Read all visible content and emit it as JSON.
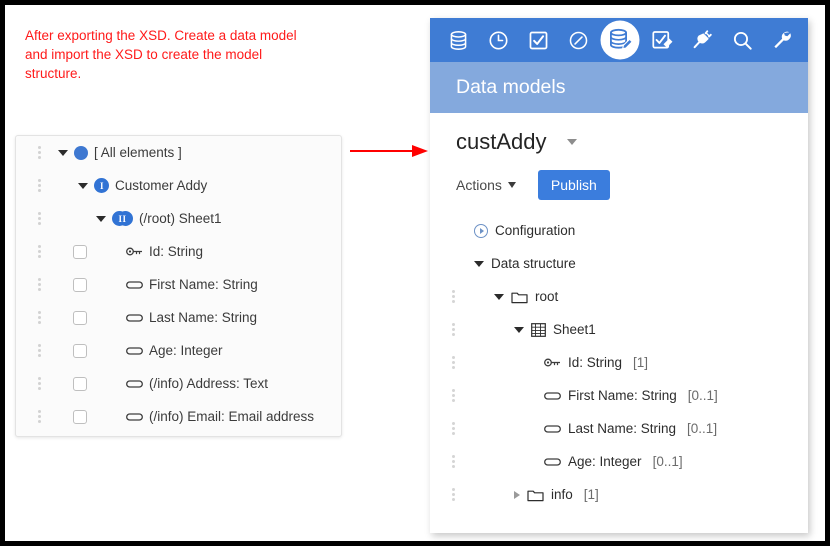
{
  "annotation": {
    "text": "After exporting the XSD. Create a data model and import the XSD to create the model structure.",
    "color": "#ff1a1a"
  },
  "arrow": {
    "name": "red-arrow",
    "color": "#ff0000"
  },
  "left_panel": {
    "rows": [
      {
        "label": "[ All elements ]",
        "icon": "blue-dot-icon",
        "caret": "down",
        "indent": 42,
        "checkbox": false
      },
      {
        "label": "Customer Addy",
        "icon": "blue-badge-i-icon",
        "caret": "down",
        "indent": 62,
        "checkbox": false
      },
      {
        "label": "(/root) Sheet1",
        "icon": "blue-badge-ii-icon",
        "caret": "down",
        "indent": 80,
        "checkbox": false
      },
      {
        "label": "Id: String",
        "icon": "key-icon",
        "caret": "none",
        "indent": 110,
        "checkbox": true
      },
      {
        "label": "First Name: String",
        "icon": "field-icon",
        "caret": "none",
        "indent": 110,
        "checkbox": true
      },
      {
        "label": "Last Name: String",
        "icon": "field-icon",
        "caret": "none",
        "indent": 110,
        "checkbox": true
      },
      {
        "label": "Age: Integer",
        "icon": "field-icon",
        "caret": "none",
        "indent": 110,
        "checkbox": true
      },
      {
        "label": "(/info) Address: Text",
        "icon": "field-icon",
        "caret": "none",
        "indent": 110,
        "checkbox": true
      },
      {
        "label": "(/info) Email: Email address",
        "icon": "field-icon",
        "caret": "none",
        "indent": 110,
        "checkbox": true
      }
    ]
  },
  "right_panel": {
    "toolbar": {
      "background": "#3f7cd4",
      "items": [
        {
          "icon": "database-icon",
          "active": false
        },
        {
          "icon": "clock-icon",
          "active": false
        },
        {
          "icon": "checkbox-checked-icon",
          "active": false
        },
        {
          "icon": "clock-circle-icon",
          "active": false
        },
        {
          "icon": "database-edit-icon",
          "active": true
        },
        {
          "icon": "checkbox-edit-icon",
          "active": false
        },
        {
          "icon": "plug-icon",
          "active": false
        },
        {
          "icon": "search-icon",
          "active": false
        },
        {
          "icon": "wrench-icon",
          "active": false
        }
      ]
    },
    "title": "Data models",
    "model_name": "custAddy",
    "actions_label": "Actions",
    "publish_label": "Publish",
    "accent_color": "#3b7ddd",
    "tree": [
      {
        "label": "Configuration",
        "icon": "circle-play-icon",
        "caret": "none",
        "indent": 44,
        "dots": false,
        "card": ""
      },
      {
        "label": "Data structure",
        "icon": "none",
        "caret": "down",
        "indent": 44,
        "dots": false,
        "card": ""
      },
      {
        "label": "root",
        "icon": "folder-icon",
        "caret": "down",
        "indent": 64,
        "dots": true,
        "card": ""
      },
      {
        "label": "Sheet1",
        "icon": "table-icon",
        "caret": "down",
        "indent": 84,
        "dots": true,
        "card": ""
      },
      {
        "label": "Id: String",
        "icon": "key-icon",
        "caret": "none",
        "indent": 114,
        "dots": true,
        "card": "[1]"
      },
      {
        "label": "First Name: String",
        "icon": "field-icon",
        "caret": "none",
        "indent": 114,
        "dots": true,
        "card": "[0..1]"
      },
      {
        "label": "Last Name: String",
        "icon": "field-icon",
        "caret": "none",
        "indent": 114,
        "dots": true,
        "card": "[0..1]"
      },
      {
        "label": "Age: Integer",
        "icon": "field-icon",
        "caret": "none",
        "indent": 114,
        "dots": true,
        "card": "[0..1]"
      },
      {
        "label": "info",
        "icon": "folder-icon",
        "caret": "right",
        "indent": 84,
        "dots": true,
        "card": "[1]"
      }
    ]
  }
}
